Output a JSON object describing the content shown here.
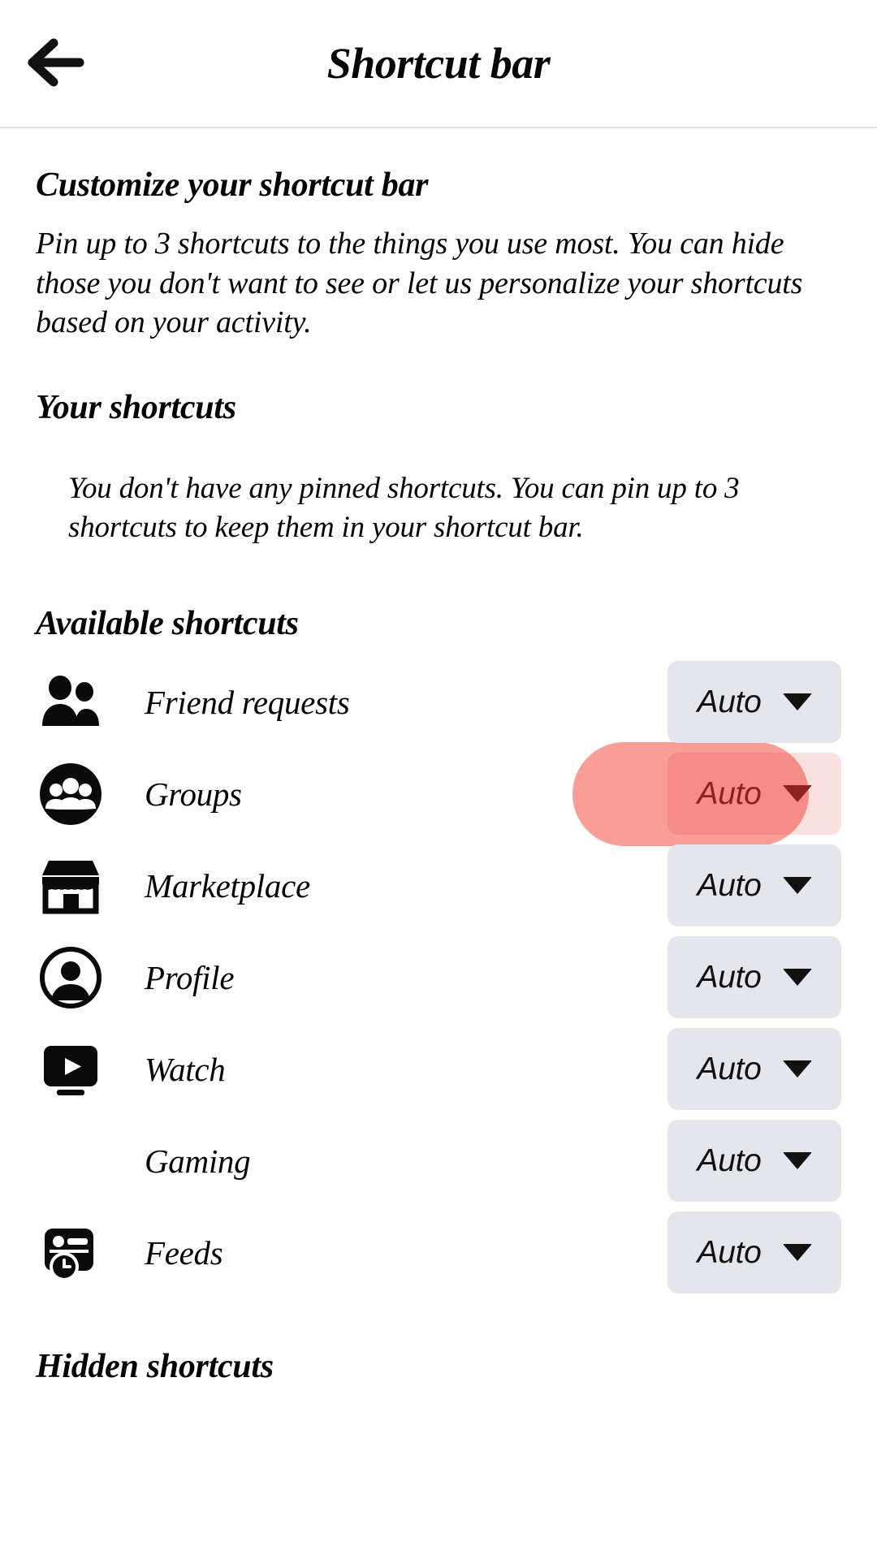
{
  "header": {
    "back_icon": "arrow-left-icon",
    "title": "Shortcut bar"
  },
  "intro": {
    "title": "Customize your shortcut bar",
    "body": "Pin up to 3 shortcuts to the things you use most. You can hide those you don't want to see or let us personalize your shortcuts based on your activity."
  },
  "your_shortcuts": {
    "title": "Your shortcuts",
    "empty_state": "You don't have any pinned shortcuts. You can pin up to 3 shortcuts to keep them in your shortcut bar."
  },
  "available_shortcuts": {
    "title": "Available shortcuts",
    "items": [
      {
        "label": "Friend requests",
        "icon": "two-people-icon",
        "value": "Auto",
        "highlighted": false
      },
      {
        "label": "Groups",
        "icon": "groups-circle-icon",
        "value": "Auto",
        "highlighted": true
      },
      {
        "label": "Marketplace",
        "icon": "storefront-icon",
        "value": "Auto",
        "highlighted": false
      },
      {
        "label": "Profile",
        "icon": "person-circle-icon",
        "value": "Auto",
        "highlighted": false
      },
      {
        "label": "Watch",
        "icon": "video-play-icon",
        "value": "Auto",
        "highlighted": false
      },
      {
        "label": "Gaming",
        "icon": "none",
        "value": "Auto",
        "highlighted": false
      },
      {
        "label": "Feeds",
        "icon": "feeds-clock-icon",
        "value": "Auto",
        "highlighted": false
      }
    ]
  },
  "hidden_shortcuts": {
    "title": "Hidden shortcuts"
  },
  "colors": {
    "background": "#ffffff",
    "text": "#050505",
    "button_background": "#e4e6eb",
    "divider": "#dcdfe3",
    "highlight": "#f44336",
    "highlight_text": "#8f2220"
  }
}
